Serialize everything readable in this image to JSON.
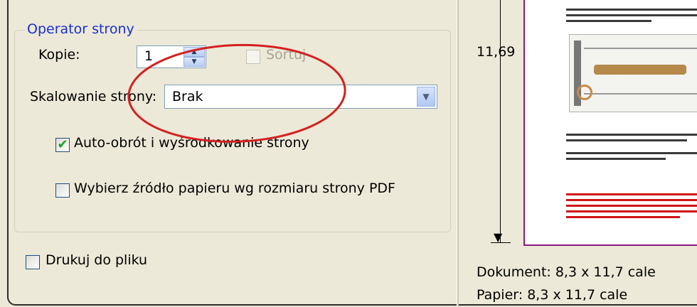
{
  "group": {
    "title": "Operator strony"
  },
  "copies": {
    "label": "Kopie:",
    "value": "1"
  },
  "sort": {
    "label": "Sortuj",
    "checked": false,
    "enabled": false
  },
  "scaling": {
    "label": "Skalowanie strony:",
    "value": "Brak"
  },
  "auto_rotate": {
    "label": "Auto-obrót i wyśrodkowanie strony",
    "checked": true
  },
  "paper_source": {
    "label": "Wybierz źródło papieru wg rozmiaru strony PDF",
    "checked": false
  },
  "print_to_file": {
    "label": "Drukuj do pliku",
    "checked": false
  },
  "preview": {
    "height_label": "11,69",
    "document_size": "Dokument: 8,3 x 11,7 cale",
    "paper_size": "Papier: 8,3 x 11,7 cale"
  },
  "colors": {
    "annotation": "#d42020",
    "group_title": "#1b2fd0",
    "preview_border": "#8a1a7f"
  }
}
